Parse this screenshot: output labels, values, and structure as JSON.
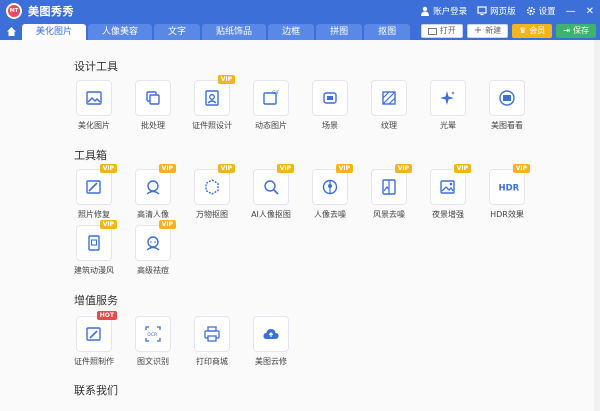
{
  "titlebar": {
    "app_title": "美图秀秀",
    "account": "账户登录",
    "web_version": "网页版",
    "settings": "设置"
  },
  "tabs": [
    "美化图片",
    "人像美容",
    "文字",
    "贴纸饰品",
    "边框",
    "拼图",
    "抠图"
  ],
  "actions": {
    "open": "打开",
    "new": "新建",
    "vip": "会员",
    "save": "保存"
  },
  "sections": {
    "design": {
      "title": "设计工具",
      "items": [
        {
          "label": "美化图片",
          "icon": "image-icon"
        },
        {
          "label": "批处理",
          "icon": "batch-icon"
        },
        {
          "label": "证件照设计",
          "icon": "id-photo-icon",
          "badge": "VIP"
        },
        {
          "label": "动态图片",
          "icon": "gif-icon"
        },
        {
          "label": "场景",
          "icon": "scene-icon"
        },
        {
          "label": "纹理",
          "icon": "texture-icon"
        },
        {
          "label": "光晕",
          "icon": "sparkle-icon"
        },
        {
          "label": "美图看看",
          "icon": "viewer-icon"
        }
      ]
    },
    "toolbox": {
      "title": "工具箱",
      "items": [
        {
          "label": "照片修复",
          "icon": "repair-icon",
          "badge": "VIP"
        },
        {
          "label": "高清人像",
          "icon": "hd-portrait-icon",
          "badge": "VIP"
        },
        {
          "label": "万物抠图",
          "icon": "cutout-icon",
          "badge": "VIP"
        },
        {
          "label": "AI人像抠图",
          "icon": "ai-cutout-icon",
          "badge": "VIP"
        },
        {
          "label": "人像去噪",
          "icon": "denoise-icon",
          "badge": "VIP"
        },
        {
          "label": "风景去噪",
          "icon": "landscape-icon",
          "badge": "VIP"
        },
        {
          "label": "夜景增强",
          "icon": "night-icon",
          "badge": "VIP"
        },
        {
          "label": "HDR效果",
          "icon": "hdr-icon",
          "badge": "VIP"
        },
        {
          "label": "建筑动漫风",
          "icon": "building-icon",
          "badge": "VIP"
        },
        {
          "label": "高级祛痘",
          "icon": "acne-icon",
          "badge": "VIP"
        }
      ]
    },
    "services": {
      "title": "增值服务",
      "items": [
        {
          "label": "证件照制作",
          "icon": "id-make-icon",
          "badge": "HOT"
        },
        {
          "label": "图文识别",
          "icon": "ocr-icon"
        },
        {
          "label": "打印商城",
          "icon": "printer-icon"
        },
        {
          "label": "美图云修",
          "icon": "cloud-icon"
        }
      ]
    },
    "contact": {
      "title": "联系我们"
    }
  },
  "colors": {
    "primary": "#3d6fd9",
    "vip": "#f2b51f",
    "hot": "#e84a4a",
    "save": "#3db36d"
  }
}
